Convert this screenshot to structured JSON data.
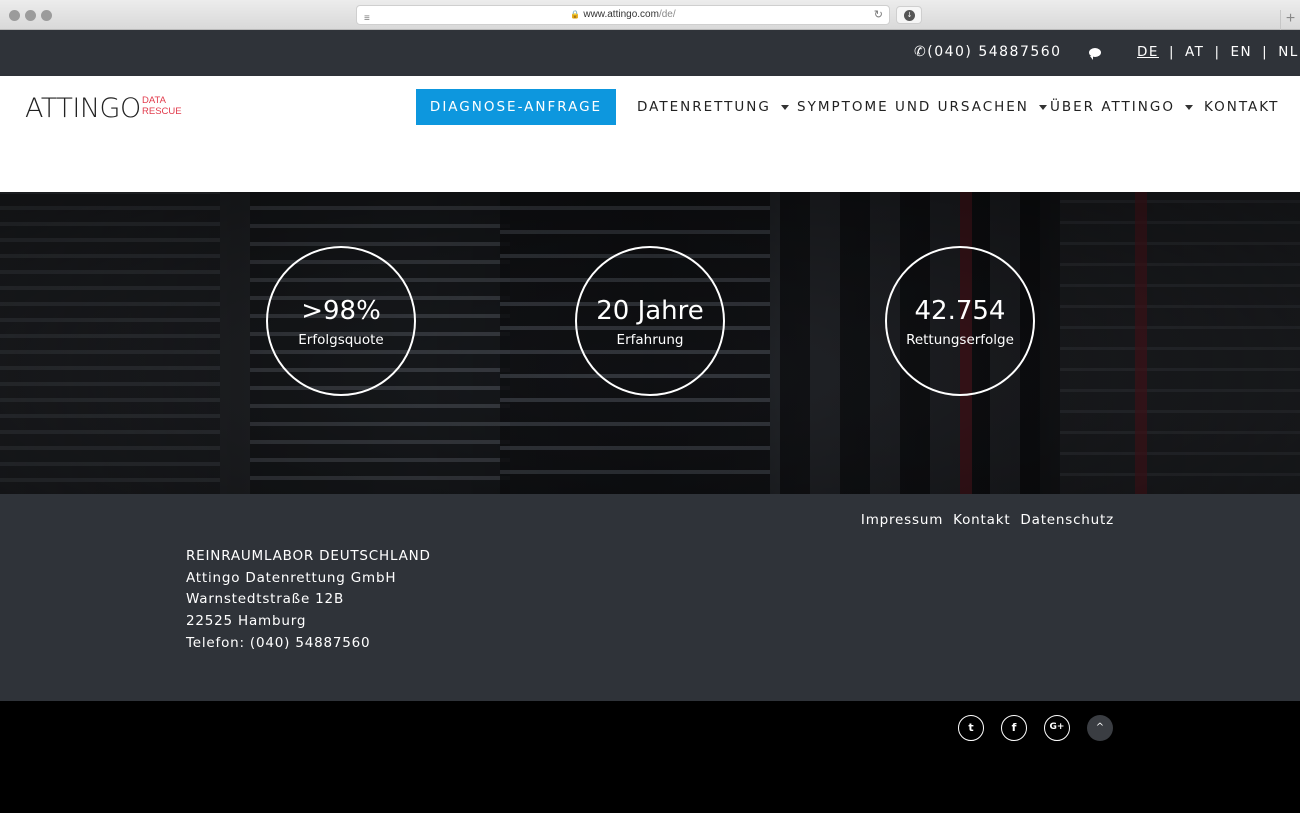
{
  "browser": {
    "url_domain": "www.attingo.com",
    "url_path": "/de/"
  },
  "topbar": {
    "phone": "(040) 54887560",
    "languages": [
      {
        "code": "DE",
        "active": true
      },
      {
        "code": "AT",
        "active": false
      },
      {
        "code": "EN",
        "active": false
      },
      {
        "code": "NL",
        "active": false
      }
    ],
    "separator": "|"
  },
  "logo": {
    "main": "ATTINGO",
    "sub_line1": "DATA",
    "sub_line2": "RESCUE",
    "accent_color": "#e23b4c"
  },
  "nav": {
    "cta_label": "DIAGNOSE-ANFRAGE",
    "cta_color": "#0d97de",
    "items": [
      {
        "label": "DATENRETTUNG",
        "has_dropdown": true
      },
      {
        "label": "SYMPTOME UND URSACHEN",
        "has_dropdown": true
      },
      {
        "label": "ÜBER ATTINGO",
        "has_dropdown": true
      },
      {
        "label": "KONTAKT",
        "has_dropdown": false
      }
    ]
  },
  "stats": [
    {
      "value": ">98%",
      "label": "Erfolgsquote"
    },
    {
      "value": "20 Jahre",
      "label": "Erfahrung"
    },
    {
      "value": "42.754",
      "label": "Rettungserfolge"
    }
  ],
  "footer": {
    "links": [
      "Impressum",
      "Kontakt",
      "Datenschutz"
    ],
    "address": [
      "REINRAUMLABOR DEUTSCHLAND",
      "Attingo Datenrettung GmbH",
      "Warnstedtstraße 12B",
      "22525 Hamburg",
      "Telefon: (040) 54887560"
    ],
    "social": [
      {
        "icon": "twitter-icon",
        "glyph": "t"
      },
      {
        "icon": "facebook-icon",
        "glyph": "f"
      },
      {
        "icon": "google-plus-icon",
        "glyph": "G+"
      }
    ],
    "back_to_top_glyph": "^"
  },
  "colors": {
    "topbar_bg": "#2f3339",
    "footer_bg": "#2f3339",
    "bottom_bg": "#000000"
  }
}
